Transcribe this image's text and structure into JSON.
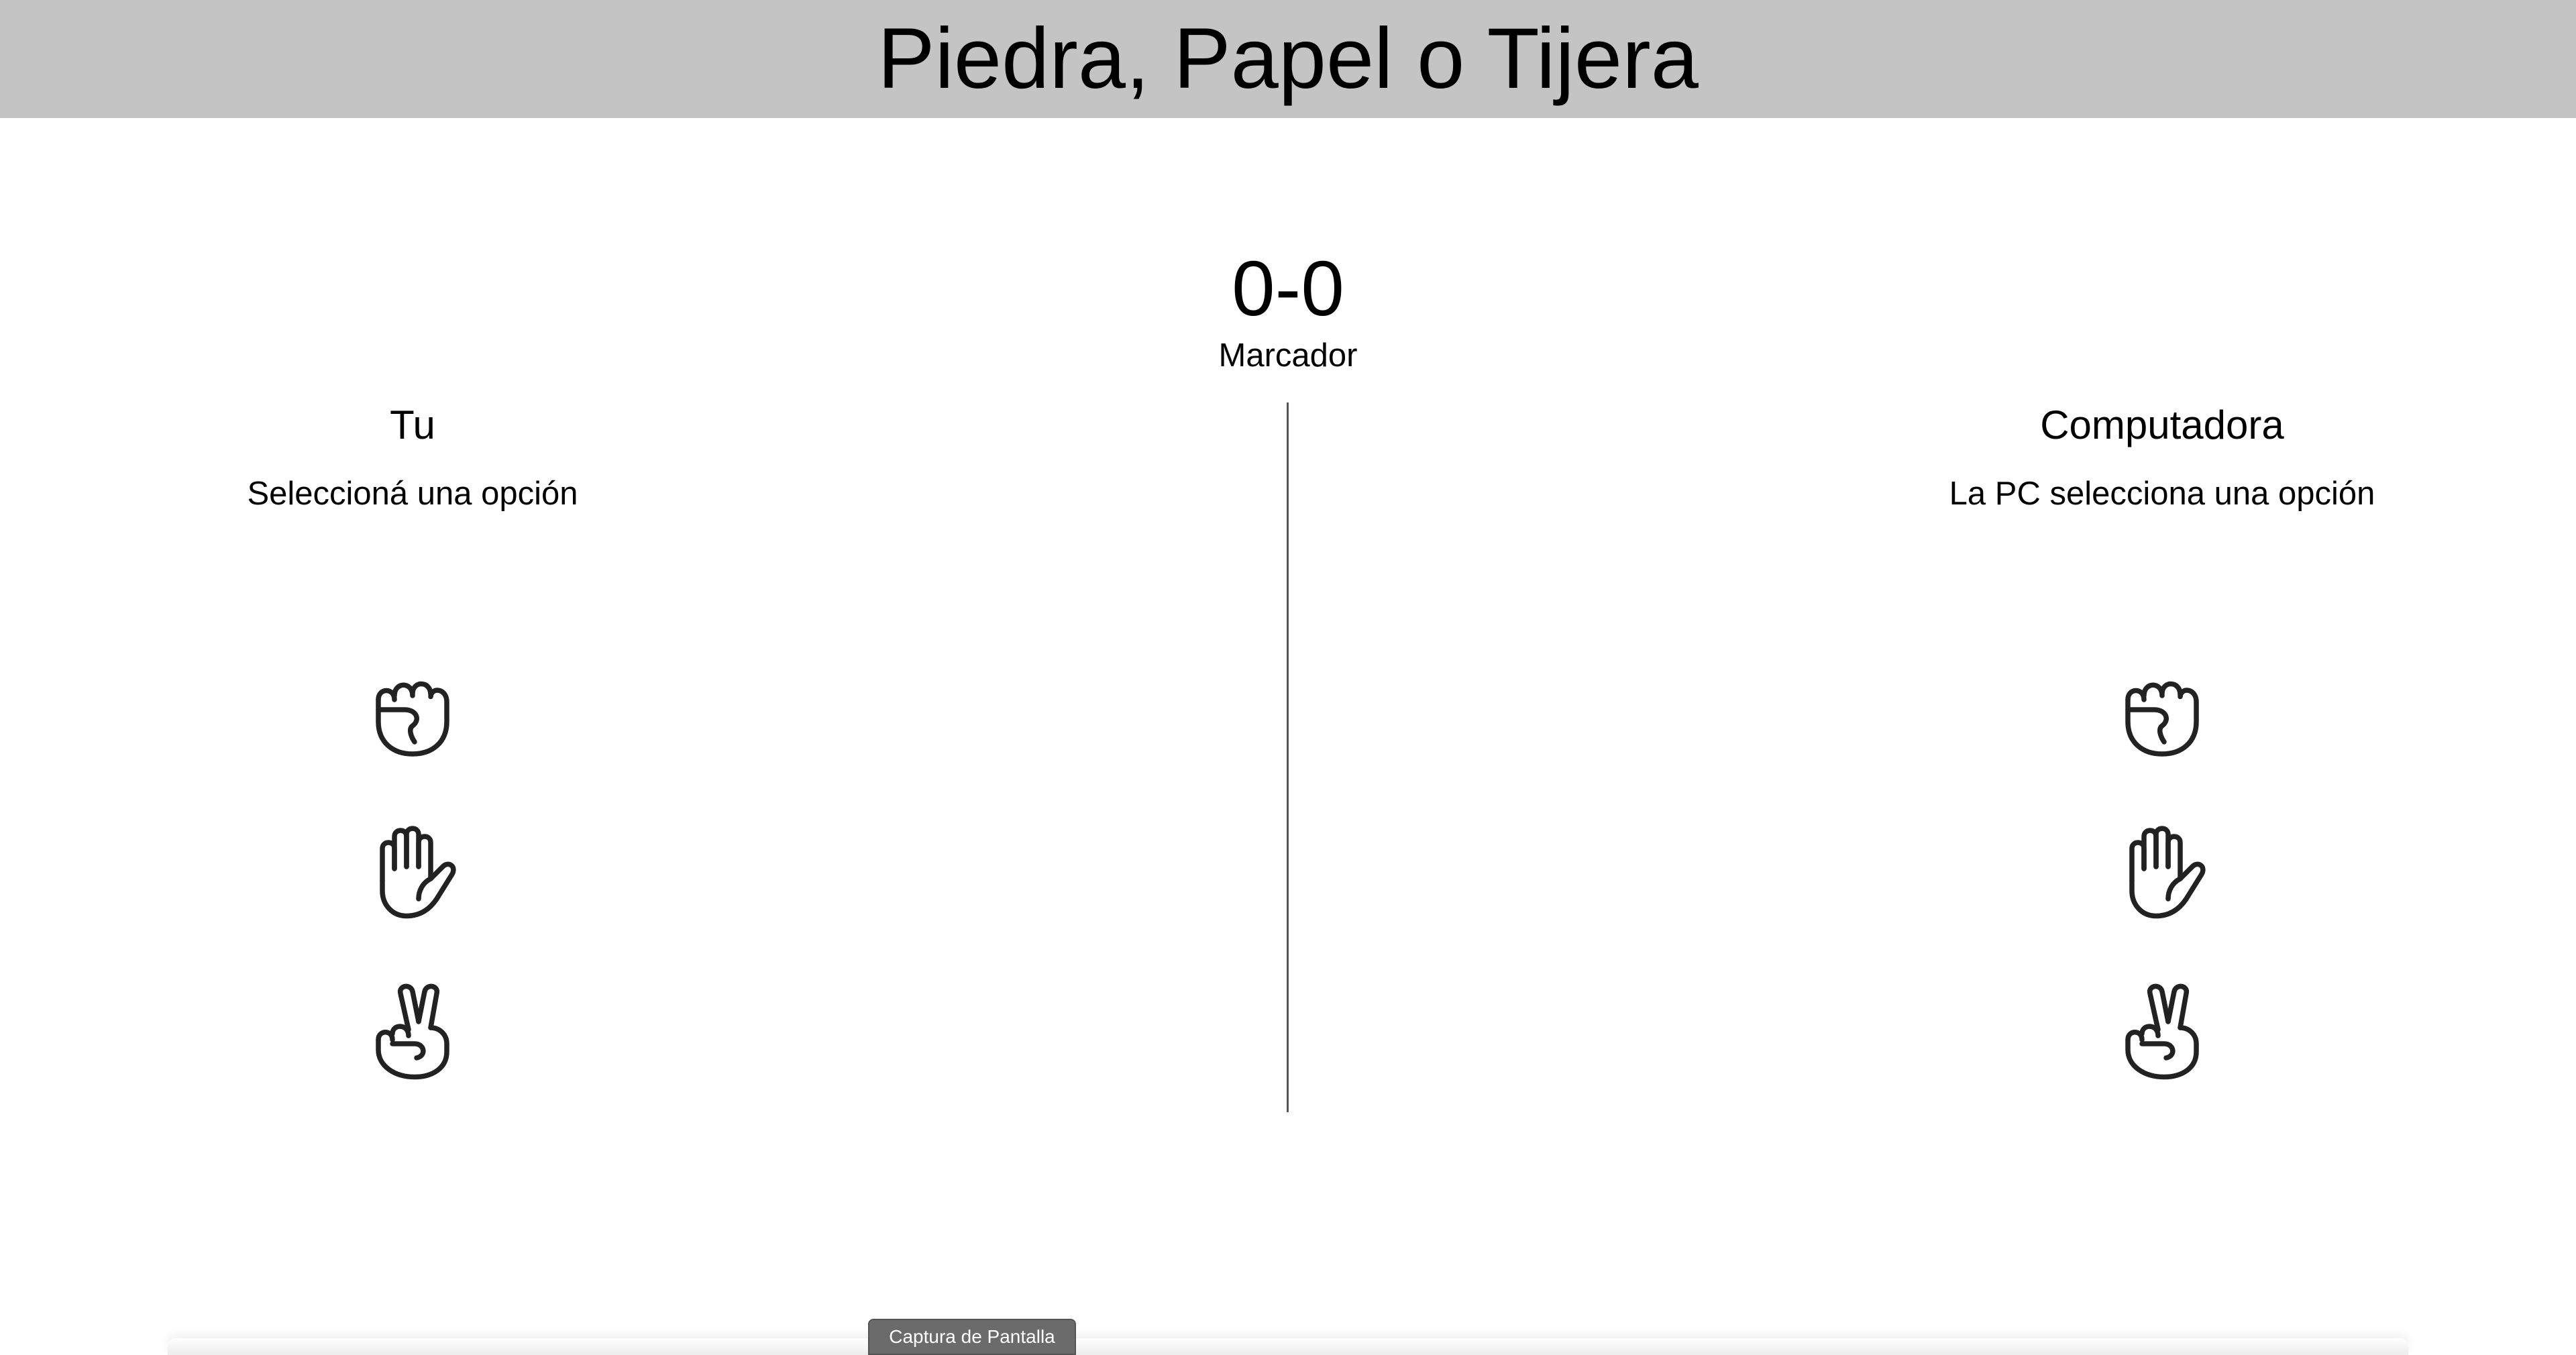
{
  "header": {
    "title": "Piedra, Papel o Tijera"
  },
  "score": {
    "value": "0-0",
    "label": "Marcador"
  },
  "user_panel": {
    "title": "Tu",
    "hint": "Seleccioná una opción",
    "choices": [
      {
        "icon": "rock-fist-icon"
      },
      {
        "icon": "paper-hand-icon"
      },
      {
        "icon": "scissors-hand-icon"
      }
    ]
  },
  "pc_panel": {
    "title": "Computadora",
    "hint": "La PC selecciona una opción",
    "choices": [
      {
        "icon": "rock-fist-icon"
      },
      {
        "icon": "paper-hand-icon"
      },
      {
        "icon": "scissors-hand-icon"
      }
    ]
  },
  "capture": {
    "button_label": "Captura de Pantalla"
  },
  "colors": {
    "header_bg": "#c4c4c4",
    "divider": "#555555",
    "capture_button": "#6b6b6b"
  }
}
